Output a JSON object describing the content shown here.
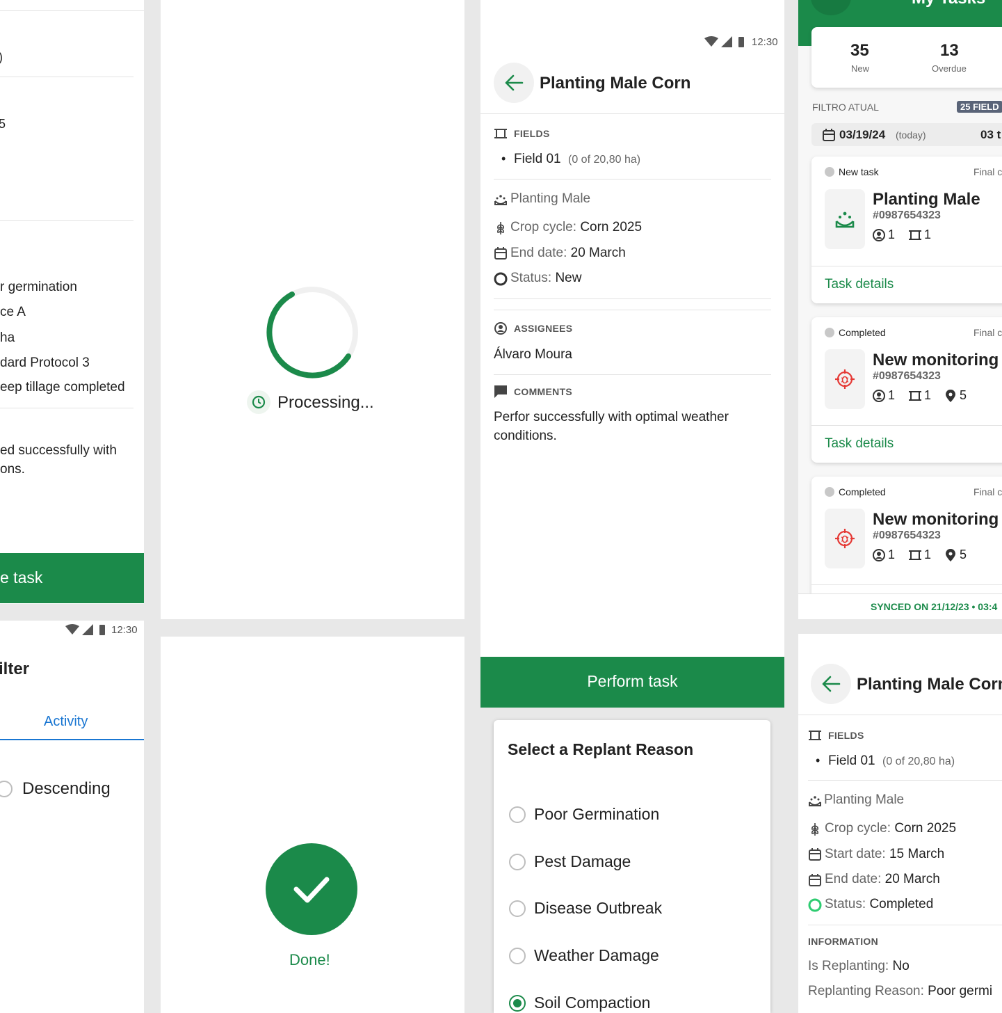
{
  "left_panel": {
    "row1": ")",
    "row2": "5",
    "details": [
      "r germination",
      "ce A",
      "ha",
      "dard Protocol 3",
      "eep tillage completed"
    ],
    "comment_l1": "ed successfully with",
    "comment_l2": "ons.",
    "button": "e task"
  },
  "status_bar": {
    "time": "12:30"
  },
  "filter_panel": {
    "title": "ilter",
    "tab": "Activity",
    "option": "Descending"
  },
  "processing": {
    "label": "Processing..."
  },
  "done": {
    "label": "Done!"
  },
  "task_detail": {
    "title": "Planting Male Corn",
    "fields_label": "FIELDS",
    "field_name": "Field 01",
    "field_area": "(0 of 20,80 ha)",
    "activity": "Planting Male",
    "crop_label": "Crop cycle:",
    "crop_value": "Corn 2025",
    "end_label": "End date:",
    "end_value": "20 March",
    "status_label": "Status:",
    "status_value": "New",
    "assignees_label": "ASSIGNEES",
    "assignee": "Álvaro Moura",
    "comments_label": "COMMENTS",
    "comment_l1": "Perfor successfully with optimal weather",
    "comment_l2": "conditions.",
    "button": "Perform task"
  },
  "replant_dialog": {
    "title": "Select a Replant Reason",
    "options": [
      {
        "label": "Poor Germination",
        "selected": false
      },
      {
        "label": "Pest Damage",
        "selected": false
      },
      {
        "label": "Disease Outbreak",
        "selected": false
      },
      {
        "label": "Weather Damage",
        "selected": false
      },
      {
        "label": "Soil Compaction",
        "selected": true
      }
    ]
  },
  "my_tasks": {
    "header_title": "My Tasks",
    "stats": [
      {
        "value": "35",
        "label": "New"
      },
      {
        "value": "13",
        "label": "Overdue"
      }
    ],
    "filter_label": "FILTRO ATUAL",
    "filter_badge": "25 FIELD",
    "date": "03/19/24",
    "date_note": "(today)",
    "date_end": "03 t",
    "cards": [
      {
        "status": "New task",
        "right": "Final c",
        "title": "Planting Male",
        "id": "#0987654323",
        "a": "1",
        "f": "1",
        "p": "",
        "link": "Task details",
        "icon": "planting-icon"
      },
      {
        "status": "Completed",
        "right": "Final c",
        "title": "New monitoring",
        "id": "#0987654323",
        "a": "1",
        "f": "1",
        "p": "5",
        "link": "Task details",
        "icon": "monitoring-icon"
      },
      {
        "status": "Completed",
        "right": "Final c",
        "title": "New monitoring",
        "id": "#0987654323",
        "a": "1",
        "f": "1",
        "p": "5",
        "link": "",
        "icon": "monitoring-icon"
      }
    ],
    "synced": "SYNCED ON 21/12/23 • 03:4"
  },
  "task_detail_2": {
    "title": "Planting Male Corn",
    "fields_label": "FIELDS",
    "field_name": "Field 01",
    "field_area": "(0 of 20,80 ha)",
    "activity": "Planting Male",
    "crop_label": "Crop cycle:",
    "crop_value": "Corn 2025",
    "start_label": "Start date:",
    "start_value": "15 March",
    "end_label": "End date:",
    "end_value": "20 March",
    "status_label": "Status:",
    "status_value": "Completed",
    "info_label": "INFORMATION",
    "replanting_label": "Is Replanting:",
    "replanting_value": "No",
    "reason_label": "Replanting Reason:",
    "reason_value": "Poor germi"
  },
  "colors": {
    "brand_green": "#1b8a4a",
    "accent_blue": "#1976d2",
    "alert_red": "#e53935"
  }
}
